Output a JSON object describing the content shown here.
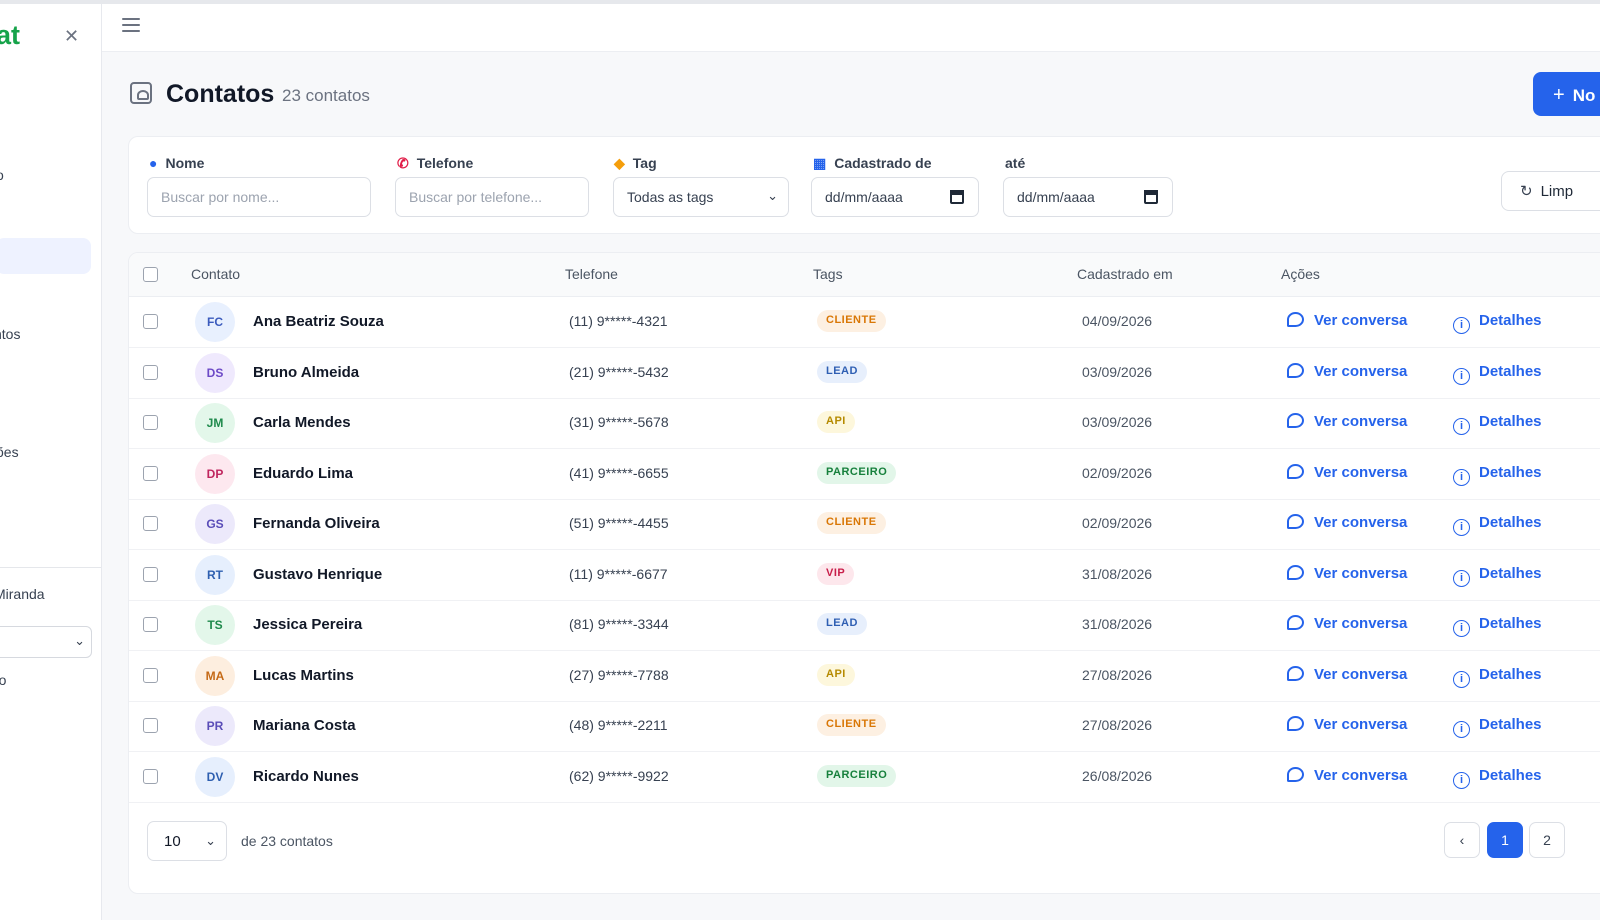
{
  "sidebar": {
    "brand": "at",
    "items": [
      {
        "label": "o"
      },
      {
        "label": "ntos"
      },
      {
        "label": "ões"
      },
      {
        "label": "Miranda"
      },
      {
        "label": "ro"
      }
    ]
  },
  "header": {
    "title": "Contatos",
    "count": "23 contatos",
    "new_button": "No"
  },
  "filters": {
    "name_label": "Nome",
    "name_placeholder": "Buscar por nome...",
    "phone_label": "Telefone",
    "phone_placeholder": "Buscar por telefone...",
    "tag_label": "Tag",
    "tag_value": "Todas as tags",
    "from_label": "Cadastrado de",
    "from_value": "dd/mm/aaaa",
    "to_label": "até",
    "to_value": "dd/mm/aaaa",
    "reset_label": "Limp"
  },
  "table": {
    "columns": [
      "Contato",
      "Telefone",
      "Tags",
      "Cadastrado em",
      "Ações"
    ],
    "action_chat": "Ver conversa",
    "action_details": "Detalhes",
    "rows": [
      {
        "initials": "FC",
        "name": "Ana Beatriz Souza",
        "phone": "(11) 9*****-4321",
        "tag": "CLIENTE",
        "date": "04/09/2026"
      },
      {
        "initials": "DS",
        "name": "Bruno Almeida",
        "phone": "(21) 9*****-5432",
        "tag": "LEAD",
        "date": "03/09/2026"
      },
      {
        "initials": "JM",
        "name": "Carla Mendes",
        "phone": "(31) 9*****-5678",
        "tag": "API",
        "date": "03/09/2026"
      },
      {
        "initials": "DP",
        "name": "Eduardo Lima",
        "phone": "(41) 9*****-6655",
        "tag": "PARCEIRO",
        "date": "02/09/2026"
      },
      {
        "initials": "GS",
        "name": "Fernanda Oliveira",
        "phone": "(51) 9*****-4455",
        "tag": "CLIENTE",
        "date": "02/09/2026"
      },
      {
        "initials": "RT",
        "name": "Gustavo Henrique",
        "phone": "(11) 9*****-6677",
        "tag": "VIP",
        "date": "31/08/2026"
      },
      {
        "initials": "TS",
        "name": "Jessica Pereira",
        "phone": "(81) 9*****-3344",
        "tag": "LEAD",
        "date": "31/08/2026"
      },
      {
        "initials": "MA",
        "name": "Lucas Martins",
        "phone": "(27) 9*****-7788",
        "tag": "API",
        "date": "27/08/2026"
      },
      {
        "initials": "PR",
        "name": "Mariana Costa",
        "phone": "(48) 9*****-2211",
        "tag": "CLIENTE",
        "date": "27/08/2026"
      },
      {
        "initials": "DV",
        "name": "Ricardo Nunes",
        "phone": "(62) 9*****-9922",
        "tag": "PARCEIRO",
        "date": "26/08/2026"
      }
    ]
  },
  "pagination": {
    "page_size": "10",
    "total_text": "de 23 contatos",
    "prev": "‹",
    "pages": [
      "1",
      "2"
    ],
    "current": "1"
  },
  "colors": {
    "accent": "#2563eb",
    "brand": "#16a34a"
  }
}
